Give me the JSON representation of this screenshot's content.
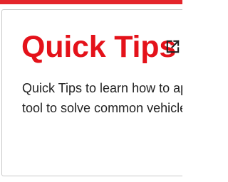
{
  "colors": {
    "accent": "#e4121a",
    "top_bar": "#e4252b",
    "text": "#222222",
    "border": "#c9c9c9"
  },
  "card": {
    "title": "Quick Tips",
    "link_icon": "external-link-icon",
    "description_lines": [
      "Quick Tips to learn how to app",
      "tool to solve common vehicle"
    ]
  }
}
